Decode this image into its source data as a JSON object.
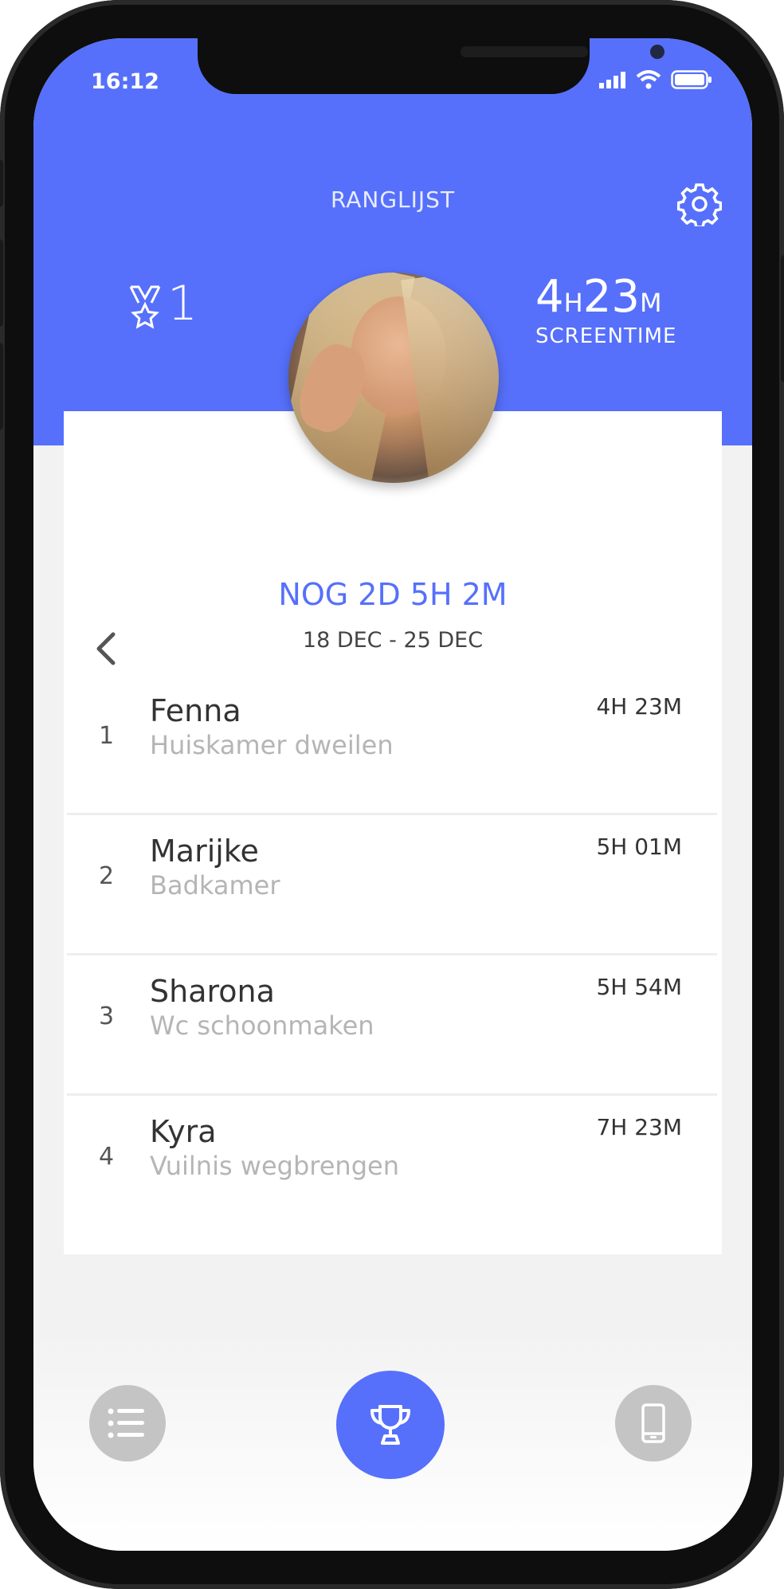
{
  "status_bar": {
    "time": "16:12"
  },
  "header": {
    "title": "RANGLIJST",
    "rank": "1",
    "screentime": {
      "hours": "4",
      "hours_unit": "H",
      "minutes": "23",
      "minutes_unit": "M",
      "label": "SCREENTIME"
    }
  },
  "period": {
    "countdown": "NOG 2D 5H 2M",
    "range": "18 DEC - 25 DEC"
  },
  "leaderboard": [
    {
      "rank": "1",
      "name": "Fenna",
      "task": "Huiskamer dweilen",
      "time": "4H 23M"
    },
    {
      "rank": "2",
      "name": "Marijke",
      "task": "Badkamer",
      "time": "5H 01M"
    },
    {
      "rank": "3",
      "name": "Sharona",
      "task": "Wc schoonmaken",
      "time": "5H 54M"
    },
    {
      "rank": "4",
      "name": "Kyra",
      "task": "Vuilnis wegbrengen",
      "time": "7H 23M"
    }
  ],
  "colors": {
    "accent": "#5670fb",
    "nav_inactive": "#c4c4c4"
  },
  "icons": [
    "signal-icon",
    "wifi-icon",
    "battery-icon",
    "gear-icon",
    "medal-icon",
    "back-chevron-icon",
    "list-icon",
    "trophy-icon",
    "phone-icon"
  ]
}
